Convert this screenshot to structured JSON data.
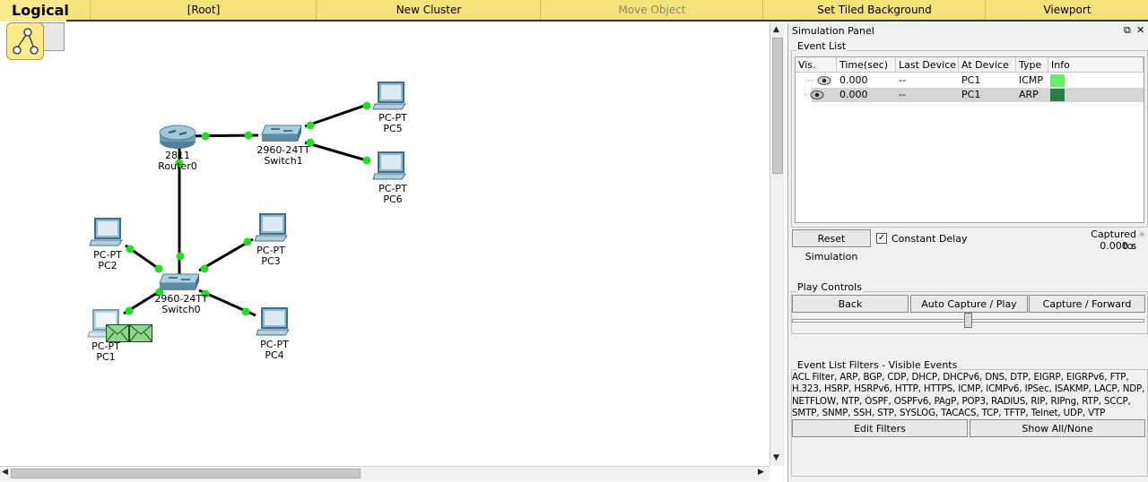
{
  "toolbar": {
    "logical": "Logical",
    "root": "[Root]",
    "new_cluster": "New Cluster",
    "move_object": "Move Object",
    "set_tiled_background": "Set Tiled Background",
    "viewport": "Viewport"
  },
  "topology": {
    "devices": {
      "router0": {
        "model": "2811",
        "name": "Router0"
      },
      "switch1": {
        "model": "2960-24TT",
        "name": "Switch1"
      },
      "switch0": {
        "model": "2960-24TT",
        "name": "Switch0"
      },
      "pc5": {
        "model": "PC-PT",
        "name": "PC5"
      },
      "pc6": {
        "model": "PC-PT",
        "name": "PC6"
      },
      "pc2": {
        "model": "PC-PT",
        "name": "PC2"
      },
      "pc3": {
        "model": "PC-PT",
        "name": "PC3"
      },
      "pc4": {
        "model": "PC-PT",
        "name": "PC4"
      },
      "pc1": {
        "model": "PC-PT",
        "name": "PC1"
      }
    },
    "link_up_color": "#22dd22",
    "pdu_color": "#8ed68e"
  },
  "panel": {
    "title": "Simulation Panel",
    "controls": [
      "⧉",
      "✕"
    ],
    "event_list": {
      "label": "Event List",
      "columns": [
        "Vis.",
        "Time(sec)",
        "Last Device",
        "At Device",
        "Type",
        "Info"
      ],
      "rows": [
        {
          "time": "0.000",
          "last": "--",
          "at": "PC1",
          "type": "ICMP",
          "color": "#66f066"
        },
        {
          "time": "0.000",
          "last": "--",
          "at": "PC1",
          "type": "ARP",
          "color": "#2e7a4a"
        }
      ]
    },
    "reset_button": "Reset Simulation",
    "constant_delay": {
      "label": "Constant Delay",
      "checked": true
    },
    "captured_to": {
      "label": "Captured to:",
      "value": "0.000 s"
    },
    "play_controls": {
      "label": "Play Controls",
      "back": "Back",
      "auto_capture": "Auto Capture / Play",
      "capture_forward": "Capture / Forward",
      "speed": 0.5
    },
    "filters": {
      "label": "Event List Filters - Visible Events",
      "text": "ACL Filter, ARP, BGP, CDP, DHCP, DHCPv6, DNS, DTP, EIGRP, EIGRPv6, FTP, H.323, HSRP, HSRPv6, HTTP, HTTPS, ICMP, ICMPv6, IPSec, ISAKMP, LACP, NDP, NETFLOW, NTP, OSPF, OSPFv6, PAgP, POP3, RADIUS, RIP, RIPng, RTP, SCCP, SMTP, SNMP, SSH, STP, SYSLOG, TACACS, TCP, TFTP, Telnet, UDP, VTP",
      "edit_button": "Edit Filters",
      "show_button": "Show All/None"
    }
  }
}
